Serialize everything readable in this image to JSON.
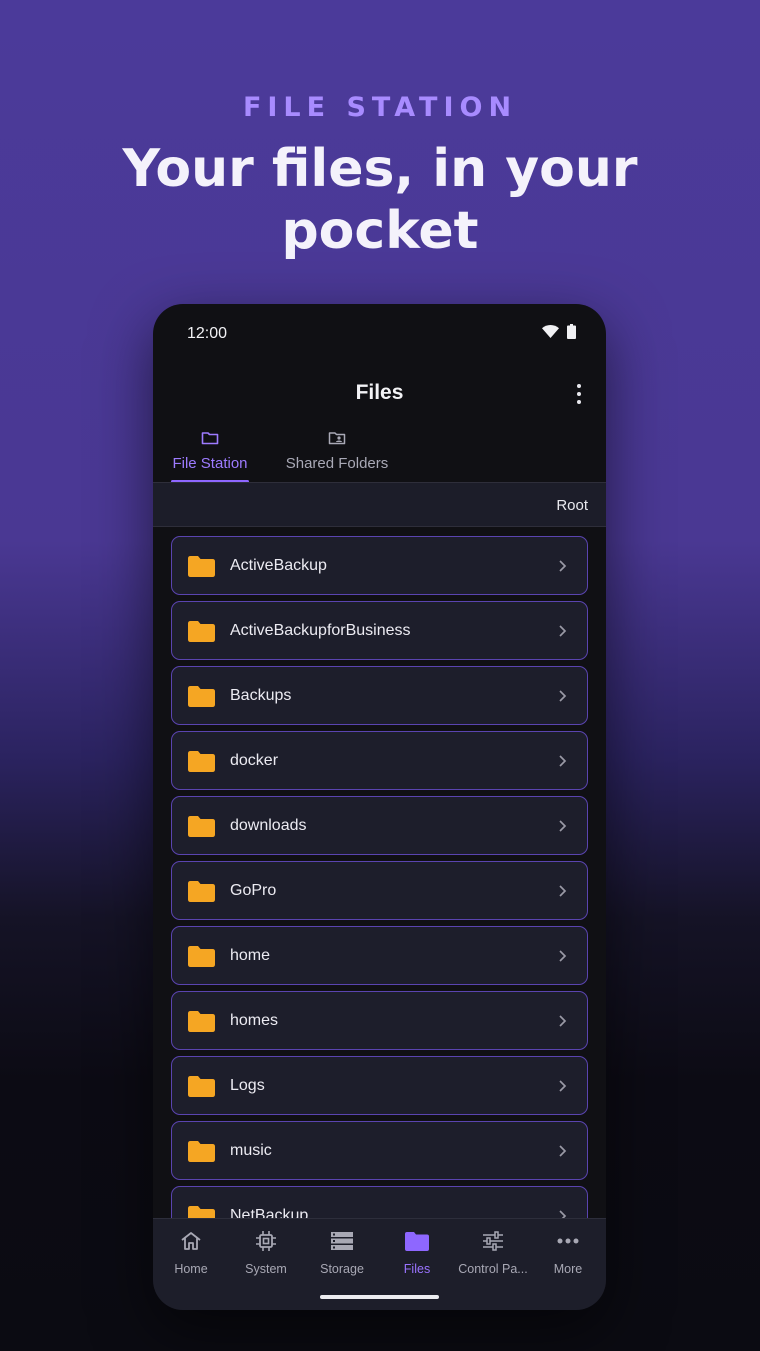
{
  "hero": {
    "kicker": "FILE STATION",
    "title": "Your files, in your pocket"
  },
  "status_bar": {
    "time": "12:00",
    "icons": [
      "wifi-icon",
      "battery-icon"
    ]
  },
  "app_bar": {
    "title": "Files",
    "menu_icon": "more-vert-icon"
  },
  "tabs": [
    {
      "label": "File Station",
      "icon": "folder-outline-icon",
      "active": true
    },
    {
      "label": "Shared Folders",
      "icon": "shared-folder-icon",
      "active": false
    }
  ],
  "breadcrumb": {
    "label": "Root"
  },
  "folders": [
    {
      "name": "ActiveBackup"
    },
    {
      "name": "ActiveBackupforBusiness"
    },
    {
      "name": "Backups"
    },
    {
      "name": "docker"
    },
    {
      "name": "downloads"
    },
    {
      "name": "GoPro"
    },
    {
      "name": "home"
    },
    {
      "name": "homes"
    },
    {
      "name": "Logs"
    },
    {
      "name": "music"
    },
    {
      "name": "NetBackup"
    }
  ],
  "bottom_nav": [
    {
      "label": "Home",
      "icon": "home-icon",
      "active": false
    },
    {
      "label": "System",
      "icon": "chip-icon",
      "active": false
    },
    {
      "label": "Storage",
      "icon": "storage-icon",
      "active": false
    },
    {
      "label": "Files",
      "icon": "folder-icon",
      "active": true
    },
    {
      "label": "Control Pa...",
      "icon": "sliders-icon",
      "active": false
    },
    {
      "label": "More",
      "icon": "more-horiz-icon",
      "active": false
    }
  ],
  "colors": {
    "accent": "#8e67ff",
    "folder": "#f5a623",
    "row_border": "#5a44b0"
  }
}
